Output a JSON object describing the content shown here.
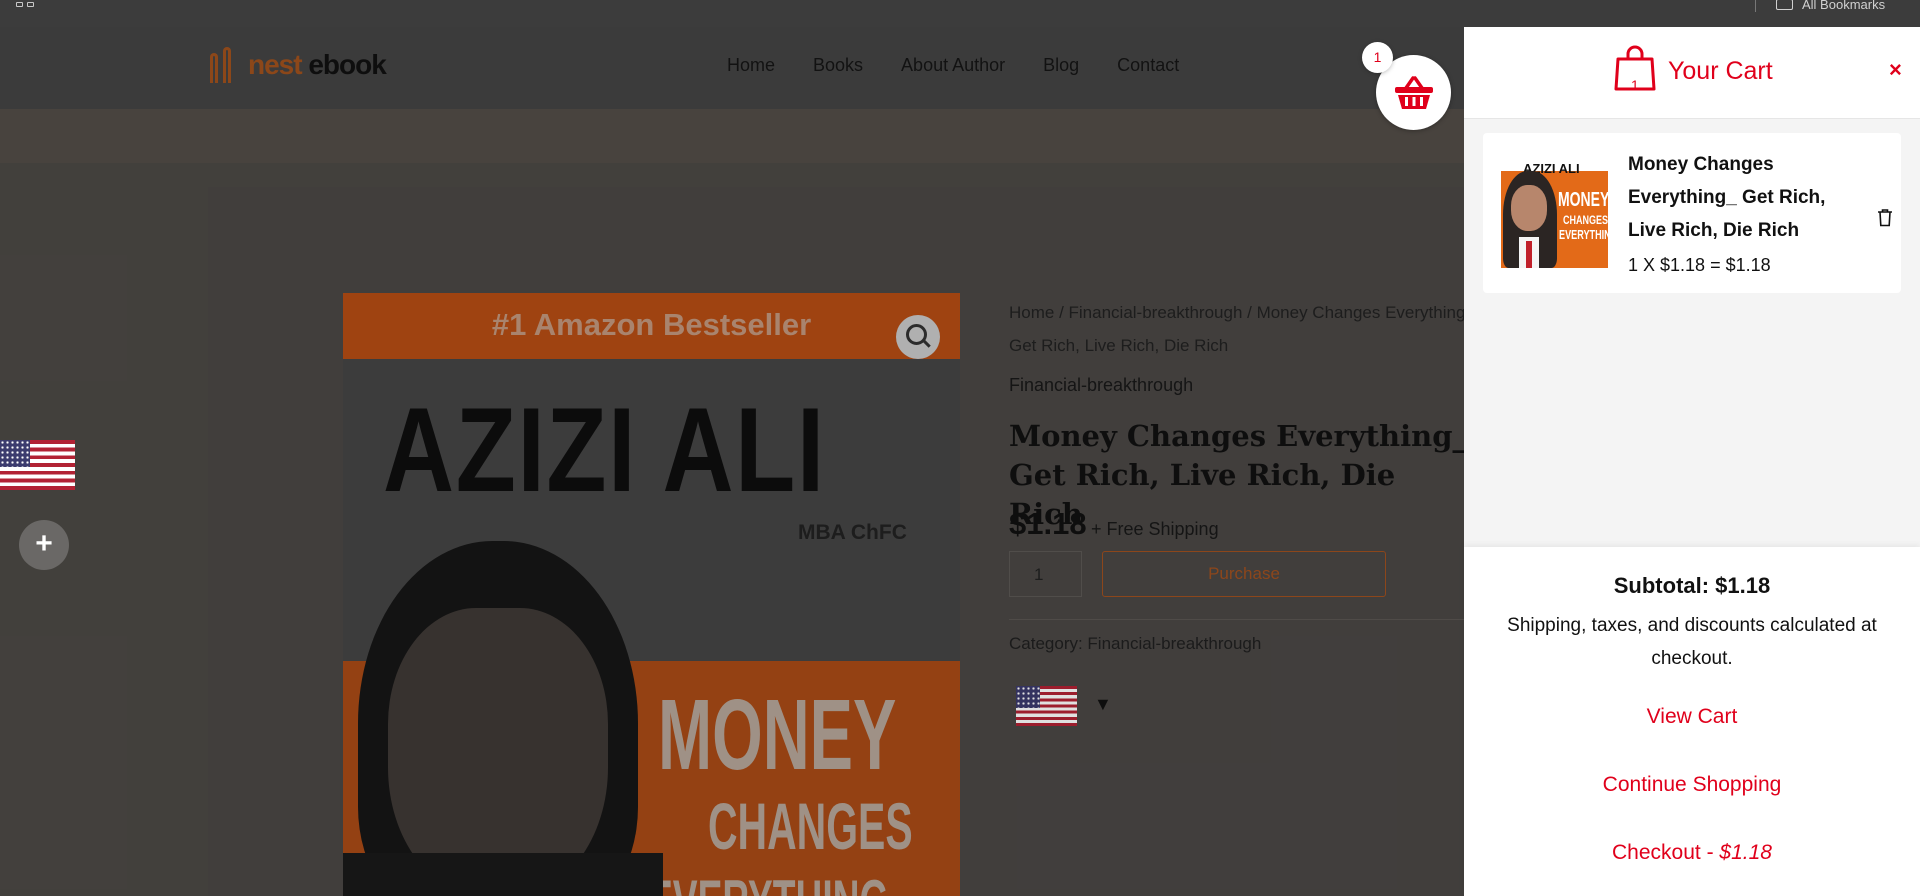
{
  "browser": {
    "all_bookmarks": "All Bookmarks"
  },
  "site": {
    "logo": {
      "part1": "nest",
      "part2": "ebook"
    },
    "nav": [
      "Home",
      "Books",
      "About Author",
      "Blog",
      "Contact"
    ]
  },
  "product": {
    "breadcrumb": "Home / Financial-breakthrough / Money Changes Everything_ Get Rich, Live Rich, Die Rich",
    "category_top": "Financial-breakthrough",
    "title": "Money Changes Everything_ Get Rich, Live Rich, Die Rich",
    "price": "$1.18",
    "shipping": "+ Free Shipping",
    "quantity": "1",
    "purchase_label": "Purchase",
    "category": "Category: Financial-breakthrough",
    "language_caret": "▼",
    "cover": {
      "banner": "#1 Amazon Bestseller",
      "author": "AZIZI ALI",
      "credentials": "MBA ChFC",
      "word1": "MONEY",
      "word2": "CHANGES",
      "word3": "EVERYTHING"
    }
  },
  "floating": {
    "plus": "+"
  },
  "cart": {
    "count": "1",
    "bag_count": "1",
    "title": "Your Cart",
    "close": "×",
    "item": {
      "title": "Money Changes Everything_ Get Rich, Live Rich, Die Rich",
      "qty_line": "1 X $1.18 = $1.18",
      "thumb": {
        "author": "AZIZI ALI",
        "word1": "MONEY",
        "word2": "CHANGES",
        "word3": "EVERYTHING"
      }
    },
    "subtotal": "Subtotal: $1.18",
    "note": "Shipping, taxes, and discounts calculated at checkout.",
    "view_cart": "View Cart",
    "continue_shopping": "Continue Shopping",
    "checkout_label": "Checkout",
    "checkout_separator": " - ",
    "checkout_amount": "$1.18"
  },
  "colors": {
    "accent": "#e0001b",
    "brand": "#a0511d"
  }
}
